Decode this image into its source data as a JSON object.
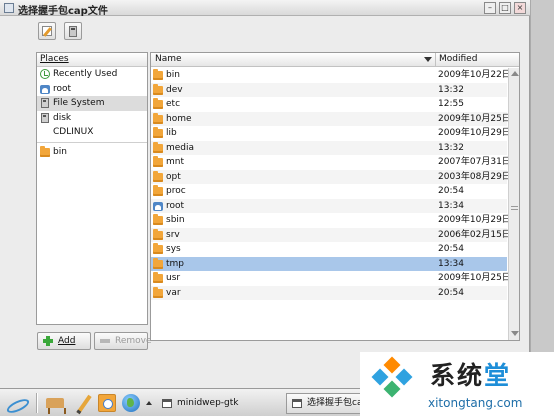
{
  "window": {
    "title": "选择握手包cap文件",
    "min_glyph": "–",
    "max_glyph": "□",
    "close_glyph": "×"
  },
  "places": {
    "header": "Places",
    "items": [
      {
        "label": "Recently Used",
        "icon": "recent-icon"
      },
      {
        "label": "root",
        "icon": "home-icon"
      },
      {
        "label": "File System",
        "icon": "drive-icon",
        "selected": true
      },
      {
        "label": "disk",
        "icon": "drive-icon"
      },
      {
        "label": "CDLINUX",
        "icon": "none"
      },
      {
        "label": "bin",
        "icon": "folder-icon"
      }
    ],
    "add_label": "Add",
    "remove_label": "Remove"
  },
  "files": {
    "col_name": "Name",
    "col_modified": "Modified",
    "rows": [
      {
        "name": "bin",
        "modified": "2009年10月22日",
        "icon": "folder-icon"
      },
      {
        "name": "dev",
        "modified": "13:32",
        "icon": "folder-icon"
      },
      {
        "name": "etc",
        "modified": "12:55",
        "icon": "folder-icon"
      },
      {
        "name": "home",
        "modified": "2009年10月25日",
        "icon": "folder-icon"
      },
      {
        "name": "lib",
        "modified": "2009年10月29日",
        "icon": "folder-icon"
      },
      {
        "name": "media",
        "modified": "13:32",
        "icon": "folder-icon"
      },
      {
        "name": "mnt",
        "modified": "2007年07月31日",
        "icon": "folder-icon"
      },
      {
        "name": "opt",
        "modified": "2003年08月29日",
        "icon": "folder-icon"
      },
      {
        "name": "proc",
        "modified": "20:54",
        "icon": "folder-icon"
      },
      {
        "name": "root",
        "modified": "13:34",
        "icon": "home-icon"
      },
      {
        "name": "sbin",
        "modified": "2009年10月29日",
        "icon": "folder-icon"
      },
      {
        "name": "srv",
        "modified": "2006年02月15日",
        "icon": "folder-icon"
      },
      {
        "name": "sys",
        "modified": "20:54",
        "icon": "folder-icon"
      },
      {
        "name": "tmp",
        "modified": "13:34",
        "icon": "folder-icon",
        "selected": true
      },
      {
        "name": "usr",
        "modified": "2009年10月25日",
        "icon": "folder-icon"
      },
      {
        "name": "var",
        "modified": "20:54",
        "icon": "folder-icon"
      }
    ]
  },
  "taskbar": {
    "tasks": [
      {
        "label": "minidwep-gtk"
      },
      {
        "label": "选择握手包cap文件"
      }
    ]
  },
  "watermark": {
    "cn_main": "系统",
    "cn_accent": "堂",
    "en": "xitongtang.com"
  },
  "colors": {
    "selection": "#a9c7ea",
    "folder": "#f2a63a"
  }
}
